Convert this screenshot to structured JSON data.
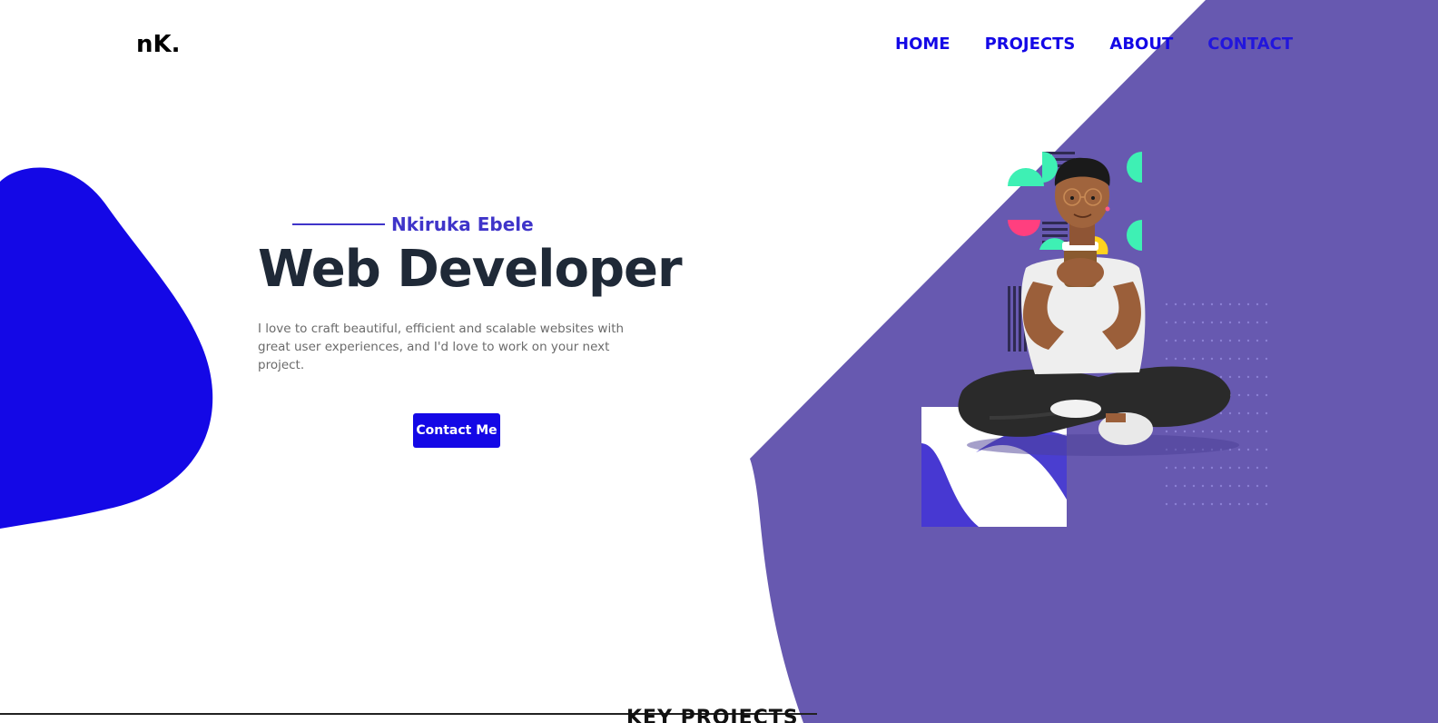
{
  "brand": {
    "logo": "nK."
  },
  "nav": {
    "items": [
      {
        "label": "HOME"
      },
      {
        "label": "PROJECTS"
      },
      {
        "label": "ABOUT"
      },
      {
        "label": "CONTACT"
      }
    ]
  },
  "hero": {
    "name": "Nkiruka Ebele",
    "title": "Web Developer",
    "description": "I love to craft beautiful, efficient and scalable websites with great user experiences, and I'd love to work on your next project.",
    "cta_label": "Contact Me"
  },
  "next_section": {
    "heading_peek": "KEY PROJECTS"
  },
  "colors": {
    "accent_blue": "#1408e6",
    "violet": "#6759b0",
    "name_purple": "#3f34c9",
    "title_dark": "#1f2937",
    "mint": "#3ef0b4",
    "pink": "#ff3f7f",
    "yellow": "#ffd21f"
  },
  "icons": {
    "illustration": "developer-avatar-illustration"
  }
}
